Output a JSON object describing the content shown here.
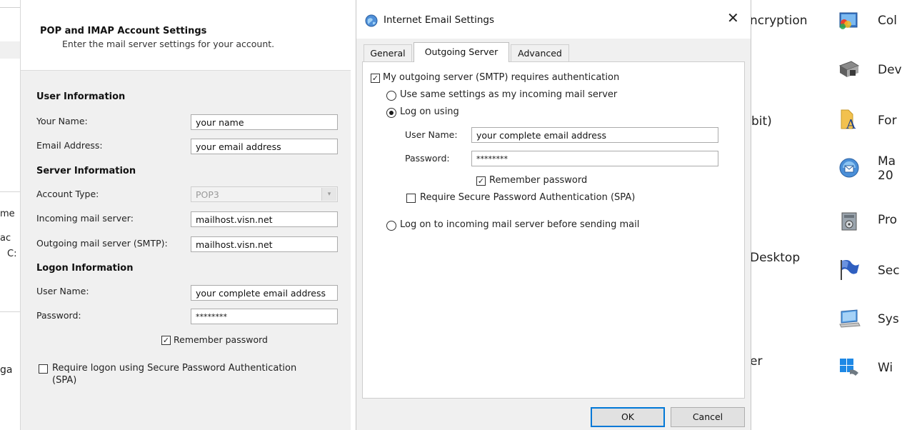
{
  "left_edge": {
    "items": [
      "me",
      "ac",
      "C:",
      "ga"
    ]
  },
  "pop": {
    "title": "POP and IMAP Account Settings",
    "subtitle": "Enter the mail server settings for your account.",
    "user_info_heading": "User Information",
    "your_name_label": "Your Name:",
    "your_name_value": "your name",
    "email_label": "Email Address:",
    "email_value": "your email address",
    "server_info_heading": "Server Information",
    "account_type_label": "Account Type:",
    "account_type_value": "POP3",
    "incoming_label": "Incoming mail server:",
    "incoming_value": "mailhost.visn.net",
    "outgoing_label": "Outgoing mail server (SMTP):",
    "outgoing_value": "mailhost.visn.net",
    "logon_info_heading": "Logon Information",
    "username_label": "User Name:",
    "username_value": "your complete email address",
    "password_label": "Password:",
    "password_value": "********",
    "remember_label": "Remember password",
    "remember_checked": true,
    "spa_label_line1": "Require logon using Secure Password Authentication",
    "spa_label_line2": "(SPA)",
    "spa_checked": false
  },
  "dialog": {
    "title": "Internet Email Settings",
    "close_glyph": "✕",
    "tabs": [
      "General",
      "Outgoing Server",
      "Advanced"
    ],
    "active_tab": "Outgoing Server",
    "smtp_auth_label": "My outgoing server (SMTP) requires authentication",
    "smtp_auth_checked": true,
    "same_settings_label": "Use same settings as my incoming mail server",
    "logon_using_label": "Log on using",
    "username_label": "User Name:",
    "username_value": "your complete email address",
    "password_label": "Password:",
    "password_value": "********",
    "remember_label": "Remember password",
    "remember_checked": true,
    "spa_label": "Require Secure Password Authentication (SPA)",
    "spa_checked": false,
    "logon_incoming_label": "Log on to incoming mail server before sending mail",
    "selected_option": "Log on using",
    "ok_label": "OK",
    "cancel_label": "Cancel"
  },
  "right_behind": {
    "texts": [
      "ncryption",
      "bit)",
      "Desktop",
      "er"
    ]
  },
  "control_panel": {
    "items": [
      {
        "label": "Col",
        "icon": "color-management-icon"
      },
      {
        "label": "Dev",
        "icon": "device-manager-icon"
      },
      {
        "label": "For",
        "icon": "fonts-icon"
      },
      {
        "label": "Ma",
        "label2": "20",
        "icon": "mail-icon"
      },
      {
        "label": "Pro",
        "icon": "programs-icon"
      },
      {
        "label": "Sec",
        "icon": "security-maintenance-icon"
      },
      {
        "label": "Sys",
        "icon": "system-icon"
      },
      {
        "label": "Wi",
        "icon": "windows-icon"
      }
    ]
  }
}
